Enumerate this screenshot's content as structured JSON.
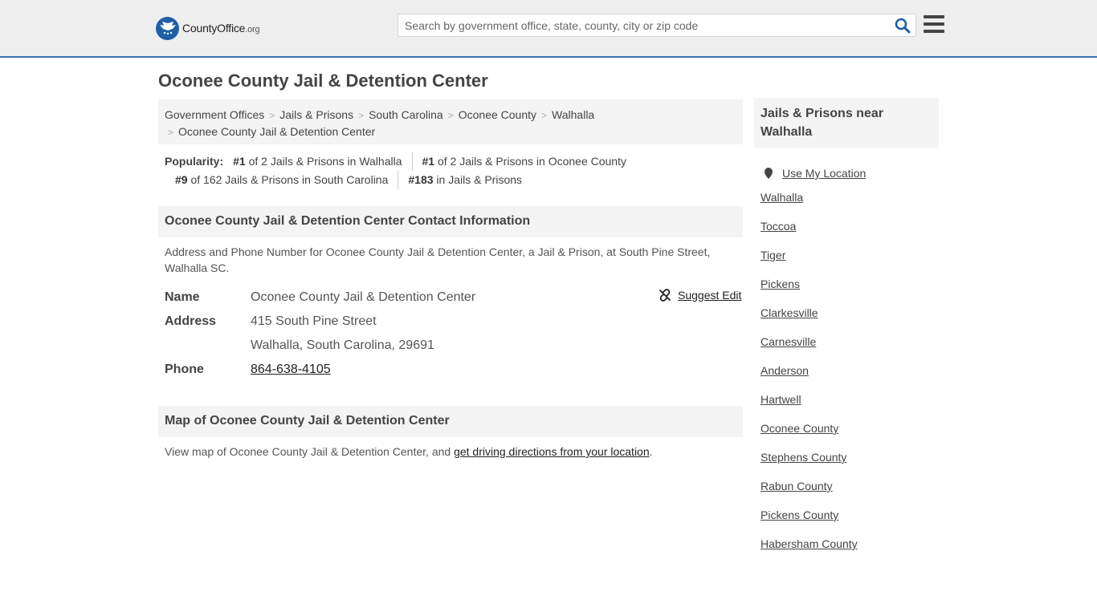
{
  "header": {
    "logo_main": "CountyOffice",
    "logo_org": ".org",
    "search_placeholder": "Search by government office, state, county, city or zip code"
  },
  "page_title": "Oconee County Jail & Detention Center",
  "breadcrumb": [
    "Government Offices",
    "Jails & Prisons",
    "South Carolina",
    "Oconee County",
    "Walhalla",
    "Oconee County Jail & Detention Center"
  ],
  "popularity": {
    "label": "Popularity:",
    "items": [
      {
        "rank": "#1",
        "text": " of 2 Jails & Prisons in Walhalla"
      },
      {
        "rank": "#1",
        "text": " of 2 Jails & Prisons in Oconee County"
      },
      {
        "rank": "#9",
        "text": " of 162 Jails & Prisons in South Carolina"
      },
      {
        "rank": "#183",
        "text": " in Jails & Prisons"
      }
    ]
  },
  "contact": {
    "heading": "Oconee County Jail & Detention Center Contact Information",
    "description": "Address and Phone Number for Oconee County Jail & Detention Center, a Jail & Prison, at South Pine Street, Walhalla SC.",
    "suggest_edit": "Suggest Edit",
    "name_label": "Name",
    "name_value": "Oconee County Jail & Detention Center",
    "address_label": "Address",
    "address_line1": "415 South Pine Street",
    "address_line2": "Walhalla, South Carolina, 29691",
    "phone_label": "Phone",
    "phone_value": "864-638-4105"
  },
  "map": {
    "heading": "Map of Oconee County Jail & Detention Center",
    "text_before": "View map of Oconee County Jail & Detention Center, and ",
    "link_text": "get driving directions from your location",
    "text_after": "."
  },
  "sidebar": {
    "heading": "Jails & Prisons near Walhalla",
    "use_location": "Use My Location",
    "links": [
      "Walhalla",
      "Toccoa",
      "Tiger",
      "Pickens",
      "Clarkesville",
      "Carnesville",
      "Anderson",
      "Hartwell",
      "Oconee County",
      "Stephens County",
      "Rabun County",
      "Pickens County",
      "Habersham County"
    ]
  },
  "colors": {
    "header_bg": "#eeeeef",
    "accent_blue": "#3d73b5",
    "logo_blue": "#1f5fa6",
    "panel_bg": "#f4f4f4"
  }
}
